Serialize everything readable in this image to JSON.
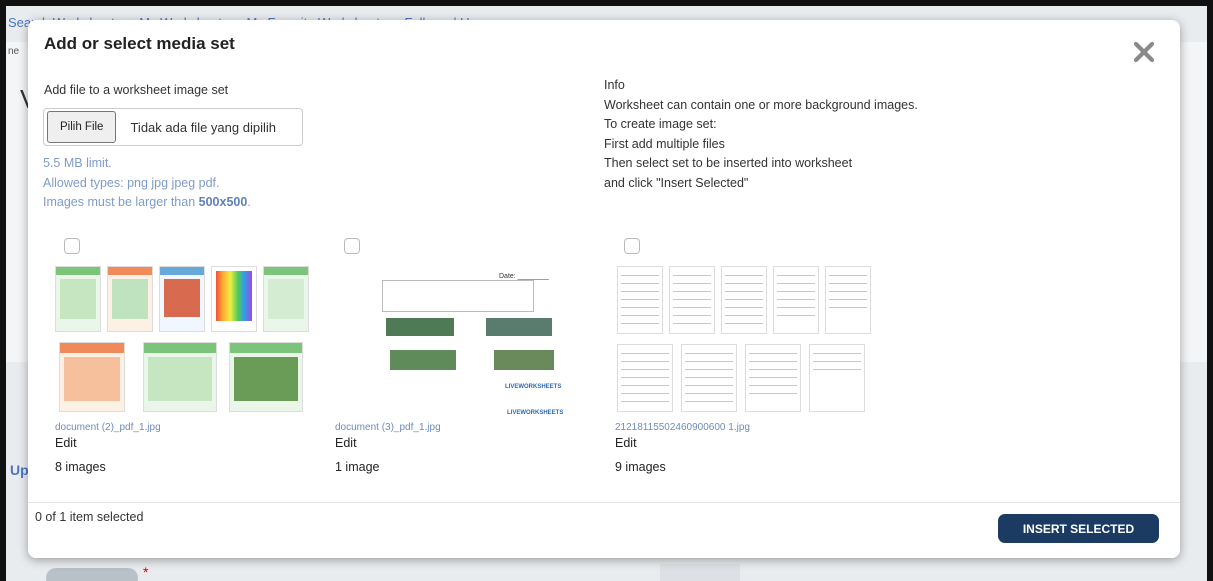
{
  "background": {
    "nav": [
      "Search Worksheets",
      "My Worksheets",
      "My Favorite Worksheets",
      "Followed Users"
    ],
    "frag_ne": "ne",
    "frag_v": "V",
    "frag_up": "Up",
    "asterisk": "*"
  },
  "modal": {
    "title": "Add or select media set",
    "upload": {
      "label": "Add file to a worksheet image set",
      "file_button": "Pilih File",
      "file_status": "Tidak ada file yang dipilih",
      "limit": "5.5 MB limit.",
      "allowed": "Allowed types: png jpg jpeg pdf.",
      "size_prefix": "Images must be larger than ",
      "size_value": "500x500",
      "size_suffix": "."
    },
    "info": [
      "Info",
      "Worksheet can contain one or more background images.",
      "To create image set:",
      "First add multiple files",
      "Then select set to be inserted into worksheet",
      "and click \"Insert Selected\""
    ],
    "sets": [
      {
        "filename": "document (2)_pdf_1.jpg",
        "edit": "Edit",
        "count": "8 images"
      },
      {
        "filename": "document (3)_pdf_1.jpg",
        "edit": "Edit",
        "count": "1 image",
        "date_label": "Date: ________",
        "brand": "LIVEWORKSHEETS"
      },
      {
        "filename": "21218115502460900600 1.jpg",
        "edit": "Edit",
        "count": "9 images"
      }
    ],
    "footer": {
      "selected": "0 of 1 item selected",
      "insert": "INSERT SELECTED"
    }
  },
  "colors": {
    "accent": "#1b3b63",
    "link": "#7f9bc8"
  }
}
